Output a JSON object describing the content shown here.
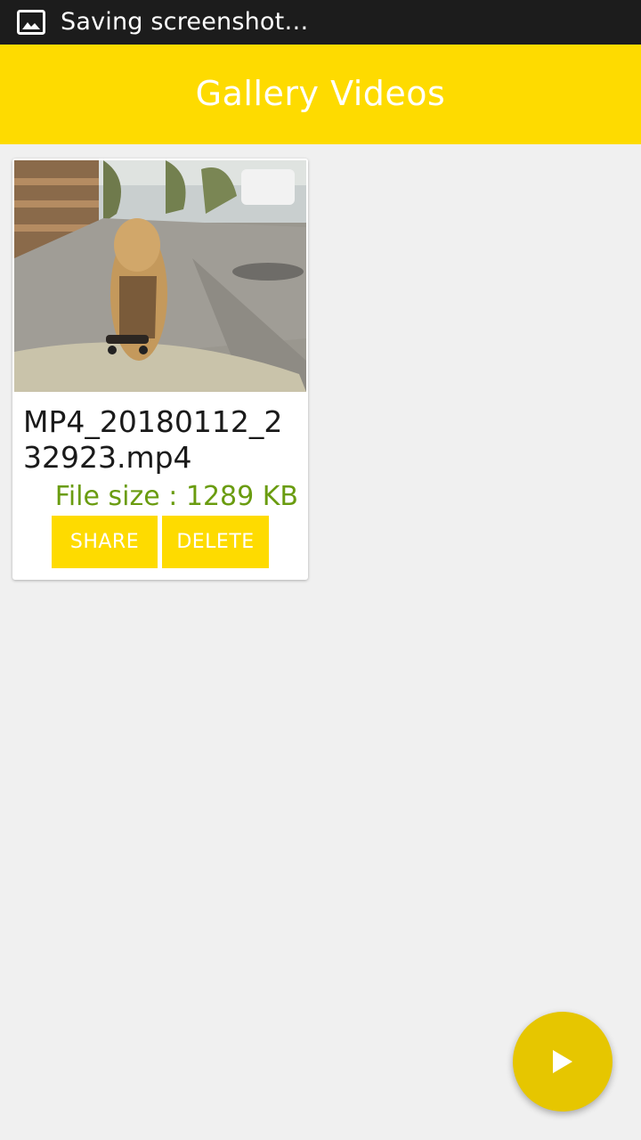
{
  "status_bar": {
    "notification_icon": "image-icon",
    "text": "Saving screenshot…"
  },
  "app_bar": {
    "title": "Gallery Videos"
  },
  "videos": [
    {
      "thumbnail": "dog-on-skateboard-thumbnail",
      "file_name": "MP4_20180112_232923.mp4",
      "file_size": "File size : 1289 KB",
      "share_label": "SHARE",
      "delete_label": "DELETE"
    }
  ],
  "fab": {
    "icon": "play-icon"
  },
  "colors": {
    "status_bar_bg": "#1c1c1c",
    "accent_yellow": "#fedb00",
    "fab_yellow": "#e6c600",
    "file_size_green": "#6a9c10",
    "background": "#f0f0f0"
  }
}
